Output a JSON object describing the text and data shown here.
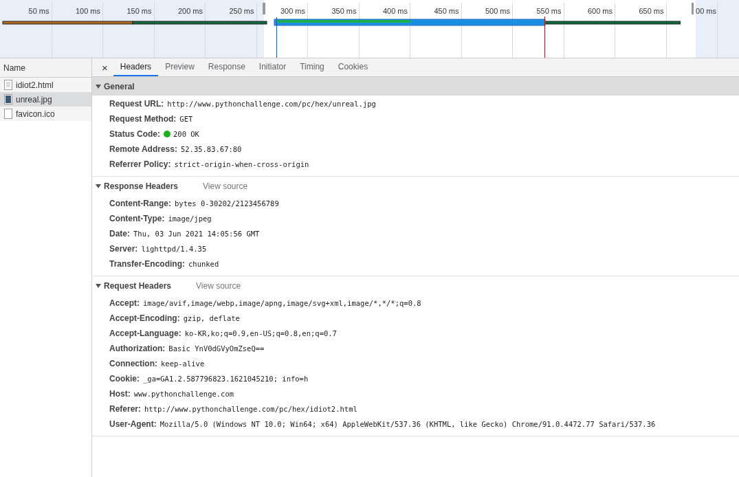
{
  "timeline": {
    "ticks": [
      "50 ms",
      "100 ms",
      "150 ms",
      "200 ms",
      "250 ms",
      "300 ms",
      "350 ms",
      "400 ms",
      "450 ms",
      "500 ms",
      "550 ms",
      "600 ms",
      "650 ms",
      "00 ms"
    ]
  },
  "requests_header": "Name",
  "requests": [
    {
      "name": "idiot2.html",
      "kind": "document",
      "selected": false
    },
    {
      "name": "unreal.jpg",
      "kind": "image",
      "selected": true
    },
    {
      "name": "favicon.ico",
      "kind": "blank",
      "selected": false
    }
  ],
  "close": "×",
  "tabs": [
    {
      "label": "Headers",
      "selected": true
    },
    {
      "label": "Preview",
      "selected": false
    },
    {
      "label": "Response",
      "selected": false
    },
    {
      "label": "Initiator",
      "selected": false
    },
    {
      "label": "Timing",
      "selected": false
    },
    {
      "label": "Cookies",
      "selected": false
    }
  ],
  "sections": [
    {
      "title": "General",
      "expanded": true,
      "highlighted": true,
      "fields": [
        {
          "name": "Request URL:",
          "value": "http://www.pythonchallenge.com/pc/hex/unreal.jpg"
        },
        {
          "name": "Request Method:",
          "value": "GET"
        },
        {
          "name": "Status Code:",
          "value": "200 OK",
          "color": "#1db31d"
        },
        {
          "name": "Remote Address:",
          "value": "52.35.83.67:80"
        },
        {
          "name": "Referrer Policy:",
          "value": "strict-origin-when-cross-origin"
        }
      ]
    },
    {
      "title": "Response Headers",
      "expanded": true,
      "highlighted": false,
      "link": "View source",
      "fields": [
        {
          "name": "Content-Range:",
          "value": "bytes 0-30202/2123456789"
        },
        {
          "name": "Content-Type:",
          "value": "image/jpeg"
        },
        {
          "name": "Date:",
          "value": "Thu, 03 Jun 2021 14:05:56 GMT"
        },
        {
          "name": "Server:",
          "value": "lighttpd/1.4.35"
        },
        {
          "name": "Transfer-Encoding:",
          "value": "chunked"
        }
      ]
    },
    {
      "title": "Request Headers",
      "expanded": true,
      "highlighted": false,
      "link": "View source",
      "fields": [
        {
          "name": "Accept:",
          "value": "image/avif,image/webp,image/apng,image/svg+xml,image/*,*/*;q=0.8"
        },
        {
          "name": "Accept-Encoding:",
          "value": "gzip, deflate"
        },
        {
          "name": "Accept-Language:",
          "value": "ko-KR,ko;q=0.9,en-US;q=0.8,en;q=0.7"
        },
        {
          "name": "Authorization:",
          "value": "Basic YnV0dGVyOmZseQ=="
        },
        {
          "name": "Connection:",
          "value": "keep-alive"
        },
        {
          "name": "Cookie:",
          "value": "_ga=GA1.2.587796823.1621045210; info=h"
        },
        {
          "name": "Host:",
          "value": "www.pythonchallenge.com"
        },
        {
          "name": "Referer:",
          "value": "http://www.pythonchallenge.com/pc/hex/idiot2.html"
        },
        {
          "name": "User-Agent:",
          "value": "Mozilla/5.0 (Windows NT 10.0; Win64; x64) AppleWebKit/537.36 (KHTML, like Gecko) Chrome/91.0.4472.77 Safari/537.36"
        }
      ]
    }
  ]
}
